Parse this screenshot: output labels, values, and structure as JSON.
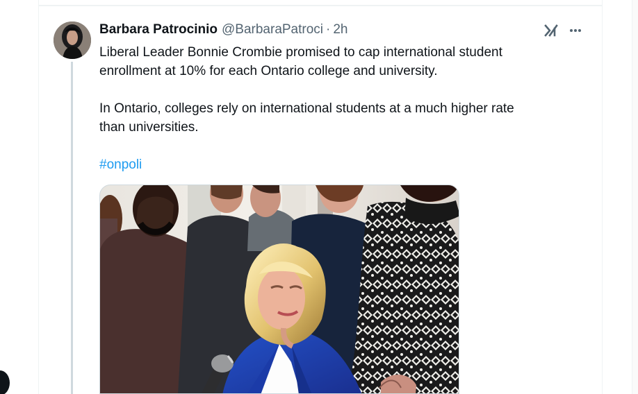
{
  "tweet": {
    "author": {
      "display_name": "Barbara Patrocinio",
      "handle": "@BarbaraPatroci",
      "separator": "·",
      "timestamp": "2h"
    },
    "body": {
      "paragraph_1_line_1": "Liberal Leader Bonnie Crombie promised to cap international student",
      "paragraph_1_line_2": "enrollment at 10% for each Ontario college and university.",
      "paragraph_2_line_1": "In Ontario, colleges rely on international students at a much higher rate",
      "paragraph_2_line_2": "than universities.",
      "hashtag": "#onpoli"
    },
    "actions": {
      "grok_icon": "grok-icon",
      "more_icon": "more-icon"
    }
  }
}
